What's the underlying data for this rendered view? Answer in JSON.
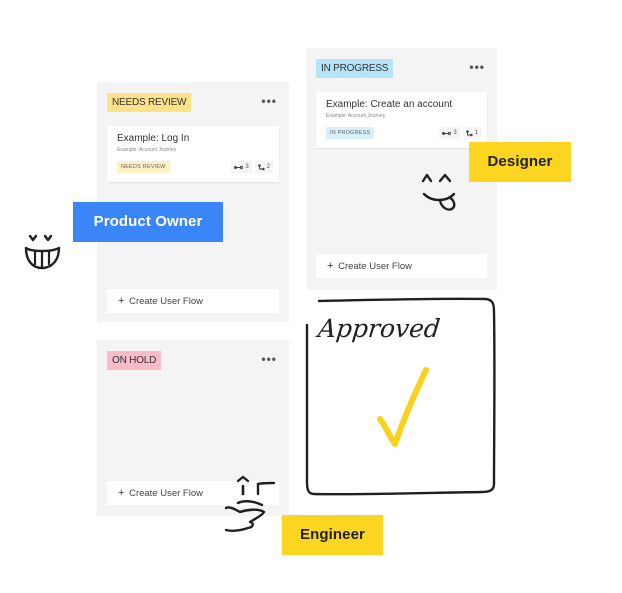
{
  "columns": [
    {
      "id": "needs-review",
      "status": "NEEDS REVIEW",
      "badge_color": "#fde28a",
      "menu_label": "•••",
      "card": {
        "title": "Example: Log In",
        "subtitle": "Example: Account Journey",
        "status": "NEEDS REVIEW",
        "steps": "3",
        "branches": "2"
      },
      "create_label": "Create User Flow"
    },
    {
      "id": "in-progress",
      "status": "IN PROGRESS",
      "badge_color": "#b5e4f8",
      "menu_label": "•••",
      "card": {
        "title": "Example: Create an account",
        "subtitle": "Example: Account Journey",
        "status": "IN PROGRESS",
        "steps": "3",
        "branches": "1"
      },
      "create_label": "Create User Flow"
    },
    {
      "id": "on-hold",
      "status": "ON HOLD",
      "badge_color": "#f8bcc9",
      "menu_label": "•••",
      "create_label": "Create User Flow"
    }
  ],
  "roles": {
    "product_owner": "Product Owner",
    "designer": "Designer",
    "engineer": "Engineer"
  },
  "colors": {
    "product_owner_bg": "#3b86f6",
    "role_yellow": "#fcd521",
    "check_yellow": "#f9d21e",
    "ink": "#1f1f24"
  },
  "approved": {
    "label": "Approved",
    "icon": "checkmark-icon"
  },
  "icons": {
    "plus": "+",
    "steps": "steps-icon",
    "branches": "branches-icon",
    "menu": "more-horizontal-icon"
  }
}
